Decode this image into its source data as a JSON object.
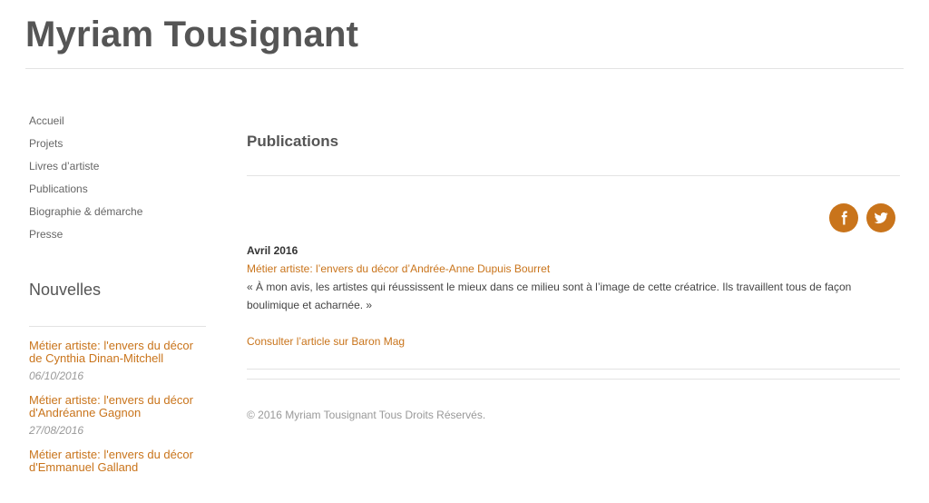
{
  "site": {
    "title": "Myriam Tousignant"
  },
  "nav": {
    "items": [
      {
        "label": "Accueil"
      },
      {
        "label": "Projets"
      },
      {
        "label": "Livres d’artiste"
      },
      {
        "label": "Publications"
      },
      {
        "label": "Biographie & démarche"
      },
      {
        "label": "Presse"
      }
    ]
  },
  "news": {
    "title": "Nouvelles",
    "items": [
      {
        "title": "Métier artiste: l'envers du décor de Cynthia Dinan-Mitchell",
        "date": "06/10/2016"
      },
      {
        "title": "Métier artiste: l'envers du décor d'Andréanne Gagnon",
        "date": "27/08/2016"
      },
      {
        "title": "Métier artiste: l'envers du décor d'Emmanuel Galland",
        "date": ""
      }
    ]
  },
  "main": {
    "title": "Publications",
    "social": [
      {
        "icon": "facebook-icon"
      },
      {
        "icon": "twitter-icon"
      }
    ],
    "post": {
      "month": "Avril 2016",
      "link": "Métier artiste: l’envers du décor d’Andrée-Anne Dupuis Bourret",
      "quote": "« À mon avis, les artistes qui réussissent le mieux dans ce milieu sont à l’image de cette créatrice. Ils travaillent tous de façon boulimique et acharnée. »",
      "consult": "Consulter l’article sur Baron Mag"
    }
  },
  "footer": {
    "copyright": "© 2016 Myriam Tousignant Tous Droits Réservés."
  },
  "colors": {
    "accent": "#c9741b"
  }
}
